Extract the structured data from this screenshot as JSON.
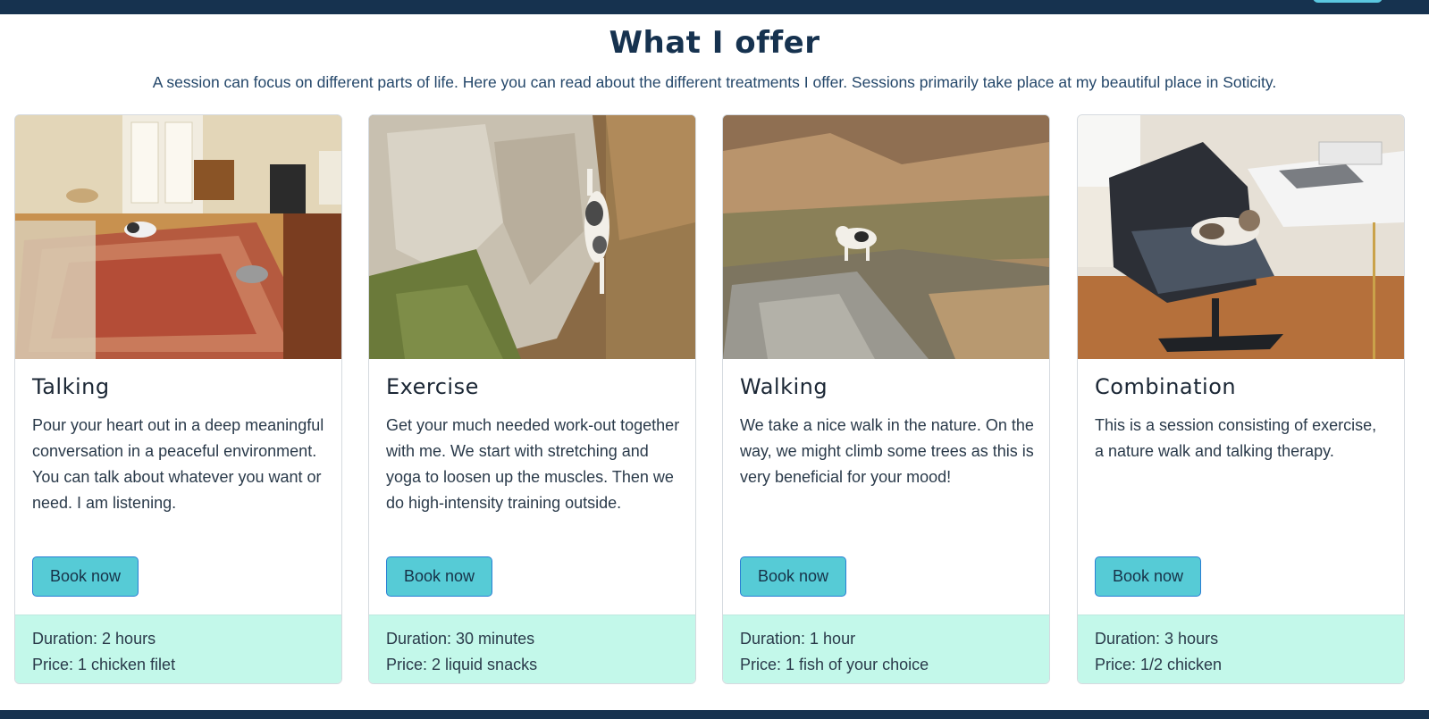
{
  "page": {
    "title": "What I offer",
    "subtitle": "A session can focus on different parts of life. Here you can read about the different treatments I offer. Sessions primarily take place at my beautiful place in Soticity."
  },
  "colors": {
    "navbar": "#16324f",
    "button": "#56cbd6",
    "footer_panel": "#c3f8ea"
  },
  "offers": [
    {
      "title": "Talking",
      "description": "Pour your heart out in a deep meaningful conversation in a peaceful environment. You can talk about whatever you want or need. I am listening.",
      "button_label": "Book now",
      "duration": "Duration: 2 hours",
      "price": "Price: 1 chicken filet"
    },
    {
      "title": "Exercise",
      "description": "Get your much needed work-out together with me. We start with stretching and yoga to loosen up the muscles. Then we do high-intensity training outside.",
      "button_label": "Book now",
      "duration": "Duration: 30 minutes",
      "price": "Price: 2 liquid snacks"
    },
    {
      "title": "Walking",
      "description": "We take a nice walk in the nature. On the way, we might climb some trees as this is very beneficial for your mood!",
      "button_label": "Book now",
      "duration": "Duration: 1 hour",
      "price": "Price: 1 fish of your choice"
    },
    {
      "title": "Combination",
      "description": "This is a session consisting of exercise, a nature walk and talking therapy.",
      "button_label": "Book now",
      "duration": "Duration: 3 hours",
      "price": "Price: 1/2 chicken"
    }
  ]
}
